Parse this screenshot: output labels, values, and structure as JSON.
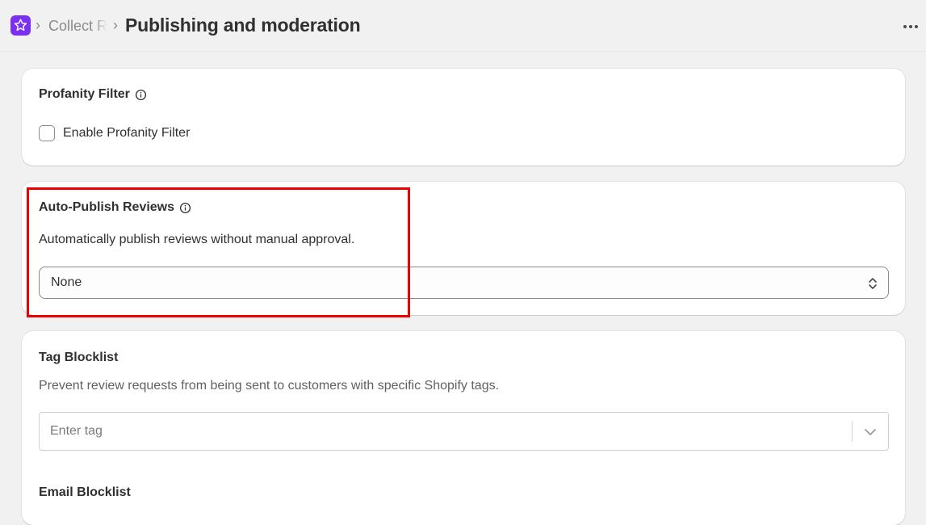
{
  "header": {
    "breadcrumb_parent": "Collect Reviews",
    "page_title": "Publishing and moderation",
    "separator": "›"
  },
  "profanity": {
    "title": "Profanity Filter",
    "checkbox_label": "Enable Profanity Filter",
    "checked": false
  },
  "auto_publish": {
    "title": "Auto-Publish Reviews",
    "description": "Automatically publish reviews without manual approval.",
    "selected_value": "None"
  },
  "tag_blocklist": {
    "title": "Tag Blocklist",
    "description": "Prevent review requests from being sent to customers with specific Shopify tags.",
    "placeholder": "Enter tag"
  },
  "email_blocklist": {
    "title": "Email Blocklist"
  },
  "colors": {
    "brand": "#7b2ff2",
    "highlight": "#ee0000",
    "background": "#f1f1f1"
  },
  "icons": [
    "app-star-logo",
    "info-icon",
    "more-horizontal-icon",
    "select-caret-icon",
    "chevron-down-icon"
  ]
}
